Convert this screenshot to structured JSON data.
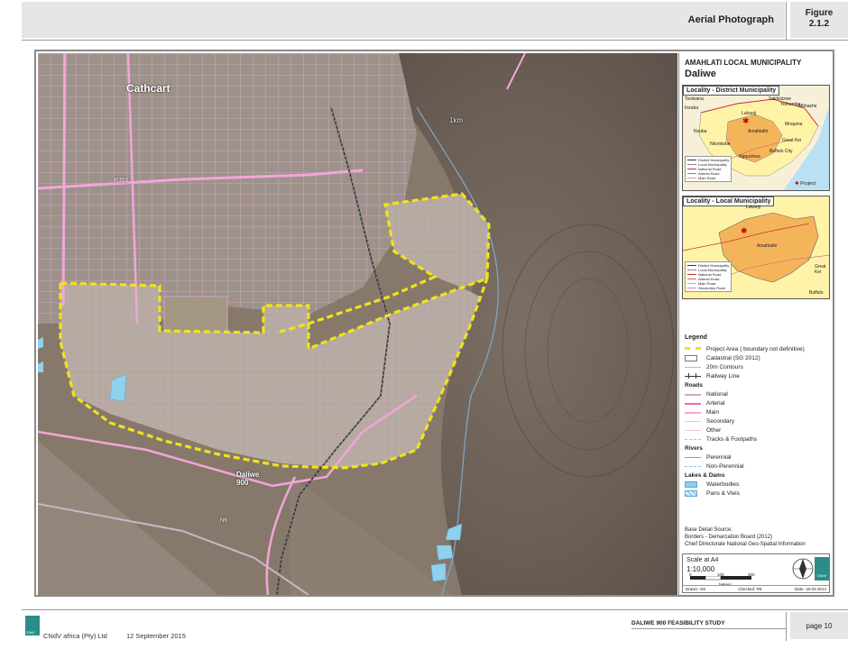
{
  "header": {
    "title": "Aerial Photograph",
    "figure_line1": "Figure",
    "figure_line2": "2.1.2"
  },
  "panel": {
    "title": "AMAHLATI LOCAL MUNICIPALITY",
    "subtitle": "Daliwe"
  },
  "inset_district": {
    "title": "Locality - District Municipality",
    "labels": [
      "Tsolwana",
      "Sakhisizwe",
      "Lukanji",
      "Mbhashe",
      "Inxuba",
      "Yethemba",
      "Mnquma",
      "Nxuba",
      "Nkonkobe",
      "Amahlathi",
      "Great Kei",
      "Buffalo City",
      "Ngqushwa",
      "Project"
    ],
    "legend": [
      "District Municipality",
      "Local Municipality",
      "National Road",
      "Arterial Road",
      "Main Road"
    ]
  },
  "inset_local": {
    "title": "Locality - Local Municipality",
    "labels": [
      "Lukanji",
      "Amahlathi",
      "Great Kei",
      "Buffalo"
    ],
    "legend": [
      "District Municipality",
      "Local Municipality",
      "National Road",
      "Arterial Road",
      "Main Road",
      "Secondary Road"
    ]
  },
  "legend": {
    "title": "Legend",
    "items": [
      {
        "kind": "item",
        "label": "Project Area ( boundary not definitive)",
        "sym": "dash-yellow"
      },
      {
        "kind": "item",
        "label": "Cadastral (SG 2012)",
        "sym": "box"
      },
      {
        "kind": "item",
        "label": "20m Contours",
        "sym": "line-contour"
      },
      {
        "kind": "item",
        "label": "Railway Line",
        "sym": "rail"
      },
      {
        "kind": "group",
        "label": "Roads"
      },
      {
        "kind": "item",
        "label": "National",
        "sym": "line-national"
      },
      {
        "kind": "item",
        "label": "Arterial",
        "sym": "line-arterial"
      },
      {
        "kind": "item",
        "label": "Main",
        "sym": "line-main"
      },
      {
        "kind": "item",
        "label": "Secondary",
        "sym": "line-secondary"
      },
      {
        "kind": "item",
        "label": "Other",
        "sym": "line-other"
      },
      {
        "kind": "item",
        "label": "Tracks & Footpaths",
        "sym": "line-tracks"
      },
      {
        "kind": "group",
        "label": "Rivers"
      },
      {
        "kind": "item",
        "label": "Perennial",
        "sym": "line-perennial"
      },
      {
        "kind": "item",
        "label": "Non-Perennial",
        "sym": "line-nonperennial"
      },
      {
        "kind": "group",
        "label": "Lakes & Dams"
      },
      {
        "kind": "item",
        "label": "Waterbodies",
        "sym": "fill-water"
      },
      {
        "kind": "item",
        "label": "Pans & Vleis",
        "sym": "fill-pans"
      }
    ]
  },
  "base_detail": {
    "line1": "Base Detail Source:",
    "line2": "Borders - Demarcation Board (2012)",
    "line3": "Chief Directorate National Geo-Spatial Information"
  },
  "scale": {
    "label": "Scale at A4",
    "ratio": "1:10,000",
    "ticks": [
      "0",
      "100",
      "200"
    ],
    "units": "Meters",
    "drawn": "Drawn: AM",
    "checked": "Checked: RE",
    "date": "Date: 18-03-2014"
  },
  "map_labels": {
    "town": "Cathcart",
    "road": "R351",
    "distance": "1km",
    "area_line1": "Daliwe",
    "area_line2": "900",
    "national_road": "N6"
  },
  "colors": {
    "project_boundary": "#f2e21a",
    "roads": "#f2a6d8",
    "water": "#8fd0ec",
    "terrain": "#6e6258",
    "district_fill": "#f4b45a",
    "district_light": "#fff3a8",
    "sea": "#b9e1f3"
  },
  "footer": {
    "company": "CNdV africa (Pty) Ltd",
    "date": "12 September 2015",
    "study": "DALIWE 900 FEASIBILITY STUDY",
    "page": "page 10"
  }
}
